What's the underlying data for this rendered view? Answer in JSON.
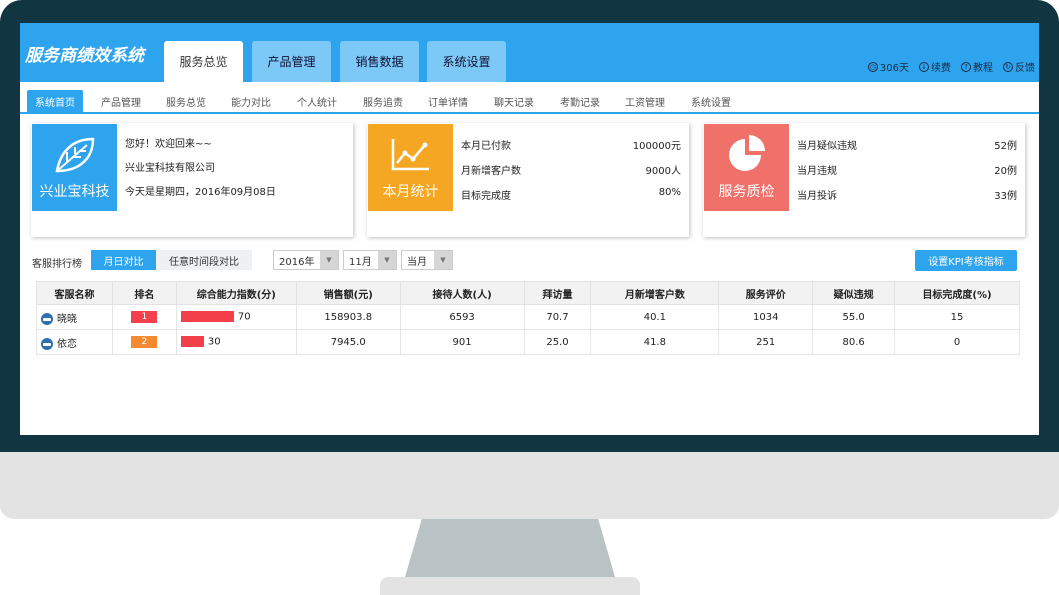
{
  "app": {
    "title": "服务商绩效系统"
  },
  "main_tabs": [
    {
      "label": "服务总览",
      "active": true
    },
    {
      "label": "产品管理",
      "active": false
    },
    {
      "label": "销售数据",
      "active": false
    },
    {
      "label": "系统设置",
      "active": false
    }
  ],
  "top_actions": [
    {
      "label": "306天",
      "icon": "clock-icon"
    },
    {
      "label": "续费",
      "icon": "download-icon"
    },
    {
      "label": "教程",
      "icon": "help-icon"
    },
    {
      "label": "反馈",
      "icon": "refresh-icon"
    }
  ],
  "sub_tabs": [
    {
      "label": "系统首页",
      "active": true
    },
    {
      "label": "产品管理"
    },
    {
      "label": "服务总览"
    },
    {
      "label": "能力对比"
    },
    {
      "label": "个人统计"
    },
    {
      "label": "服务追责"
    },
    {
      "label": "订单详情"
    },
    {
      "label": "聊天记录"
    },
    {
      "label": "考勤记录"
    },
    {
      "label": "工资管理"
    },
    {
      "label": "系统设置"
    }
  ],
  "welcome_card": {
    "logo_text": "兴业宝科技",
    "greeting": "您好！欢迎回来~~",
    "company": "兴业宝科技有限公司",
    "date_text": "今天是星期四，2016年09月08日",
    "color": "#2ea4ee"
  },
  "monthly_card": {
    "title": "本月统计",
    "color": "#f5a623",
    "rows": [
      {
        "label": "本月已付款",
        "value": "100000元"
      },
      {
        "label": "月新增客户数",
        "value": "9000人"
      },
      {
        "label": "目标完成度",
        "value": "80%"
      }
    ]
  },
  "quality_card": {
    "title": "服务质检",
    "color": "#f0706a",
    "rows": [
      {
        "label": "当月疑似违规",
        "value": "52例"
      },
      {
        "label": "当月违规",
        "value": "20例"
      },
      {
        "label": "当月投诉",
        "value": "33例"
      }
    ]
  },
  "ranking": {
    "label": "客服排行榜",
    "seg_on": "月日对比",
    "seg_off": "任意时间段对比",
    "year": "2016年",
    "month": "11月",
    "period": "当月",
    "kpi_button": "设置KPI考核指标"
  },
  "table": {
    "headers": [
      "客服名称",
      "排名",
      "综合能力指数(分)",
      "销售额(元)",
      "接待人数(人)",
      "拜访量",
      "月新增客户数",
      "服务评价",
      "疑似违规",
      "目标完成度(%)"
    ],
    "rows": [
      {
        "name": "晓晓",
        "rank": "1",
        "rank_color": "#f3404a",
        "score": "70",
        "score_value": 70,
        "sales": "158903.8",
        "visitors": "6593",
        "visits": "70.7",
        "new_customers": "40.1",
        "rating": "1034",
        "suspected": "55.0",
        "completion": "15"
      },
      {
        "name": "依恋",
        "rank": "2",
        "rank_color": "#f58a33",
        "score": "30",
        "score_value": 30,
        "sales": "7945.0",
        "visitors": "901",
        "visits": "25.0",
        "new_customers": "41.8",
        "rating": "251",
        "suspected": "80.6",
        "completion": "0"
      }
    ]
  }
}
